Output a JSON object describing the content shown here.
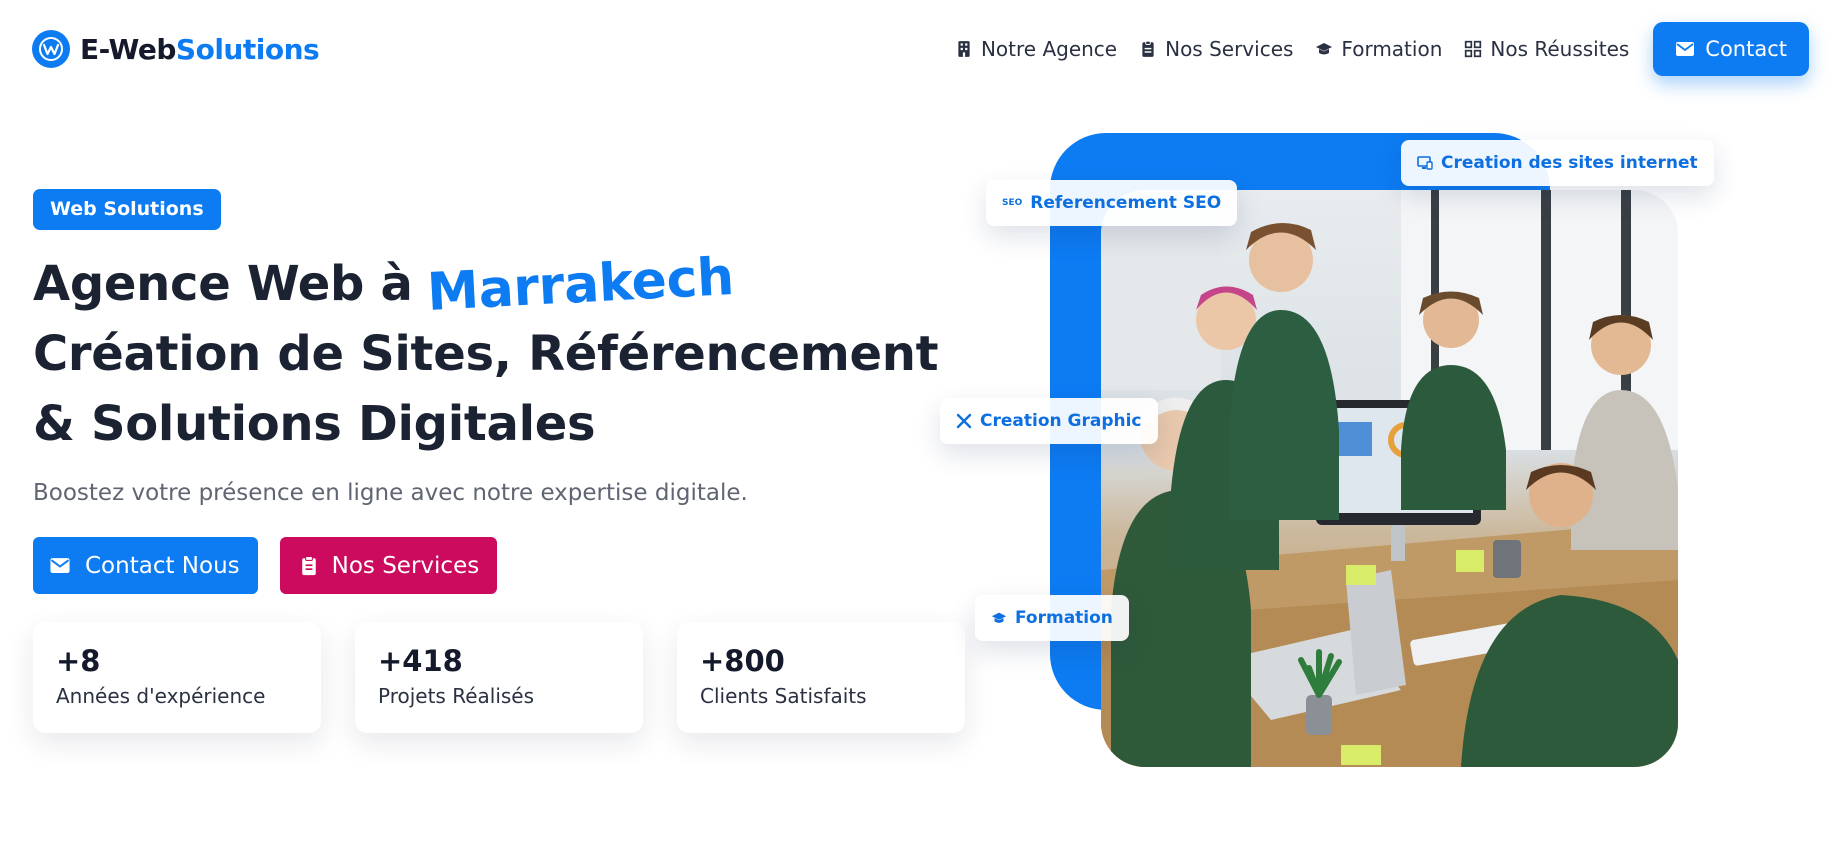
{
  "header": {
    "logo": {
      "part1": "E-Web",
      "part2": "Solutions"
    },
    "nav": [
      {
        "label": "Notre Agence",
        "icon": "building-icon"
      },
      {
        "label": "Nos Services",
        "icon": "clipboard-icon"
      },
      {
        "label": "Formation",
        "icon": "graduation-cap-icon"
      },
      {
        "label": "Nos Réussites",
        "icon": "grid-icon"
      }
    ],
    "contact_label": "Contact"
  },
  "hero": {
    "badge": "Web Solutions",
    "title_line1": "Agence Web à",
    "title_highlight": "Marrakech",
    "title_line2": "Création de Sites, Référencement",
    "title_line3": "& Solutions Digitales",
    "subtitle": "Boostez votre présence en ligne avec notre expertise digitale.",
    "btn_contact": "Contact Nous",
    "btn_services": "Nos Services"
  },
  "stats": [
    {
      "value": "+8",
      "label": "Années d'expérience"
    },
    {
      "value": "+418",
      "label": "Projets Réalisés"
    },
    {
      "value": "+800",
      "label": "Clients Satisfaits"
    }
  ],
  "chips": {
    "sites": "Creation des sites internet",
    "seo": "Referencement SEO",
    "seo_icon_text": "SEO",
    "graphic": "Creation Graphic",
    "formation": "Formation"
  },
  "colors": {
    "primary": "#0d7bf2",
    "accent": "#cc0a5e",
    "heading": "#1b2232",
    "muted": "#5f6573"
  }
}
